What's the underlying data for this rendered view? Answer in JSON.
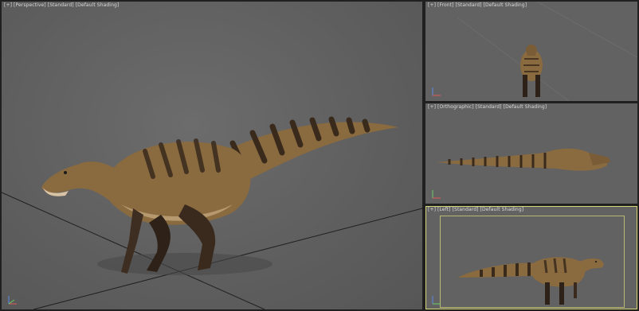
{
  "viewports": {
    "perspective": {
      "label": "[+] [Perspective] [Standard] [Default Shading]"
    },
    "front": {
      "label": "[+] [Front] [Standard] [Default Shading]"
    },
    "top": {
      "label": "[+] [Orthographic] [Standard] [Default Shading]"
    },
    "left": {
      "label": "[+] [Left] [Standard] [Default Shading]"
    }
  },
  "colors": {
    "viewport_bg": "#626262",
    "border": "#202020",
    "active_frame": "#d6d678",
    "model_body": "#8a6a3f",
    "model_stripes": "#3a2a1c",
    "model_belly": "#d8c4a4"
  },
  "icons": {
    "axis": "axis-tripod-icon"
  }
}
